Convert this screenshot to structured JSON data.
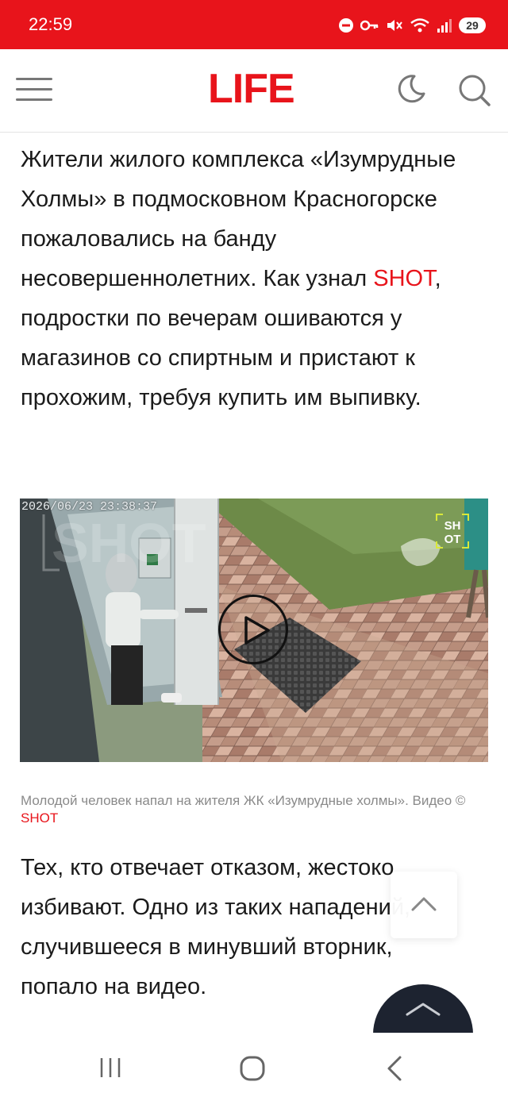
{
  "status_bar": {
    "time": "22:59",
    "icons": [
      "do-not-disturb-icon",
      "key-icon",
      "mute-icon",
      "wifi-icon",
      "signal-icon"
    ],
    "battery": "29"
  },
  "header": {
    "logo": "LIFE",
    "menu_icon": "hamburger-menu-icon",
    "theme_icon": "moon-icon",
    "search_icon": "search-icon"
  },
  "article": {
    "paragraph1_before": "Жители жилого комплекса «Изумрудные Холмы» в подмосковном Красногорске пожаловались на банду несовершеннолетних. Как узнал ",
    "paragraph1_link": "SHOT",
    "paragraph1_after": ", подростки по вечерам ошиваются у магазинов со спиртным и пристают к прохожим, требуя купить им выпивку.",
    "video": {
      "timestamp": "2026/06/23 23:38:37",
      "watermark": "SHOT",
      "play_icon": "play-icon"
    },
    "caption_text": "Молодой человек напал на жителя ЖК «Изумрудные холмы». Видео © ",
    "caption_link": "SHOT",
    "paragraph2": "Тех, кто отвечает отказом, жестоко избивают. Одно из таких нападений, случившееся в минувший вторник, попало на видео."
  },
  "floating": {
    "scroll_up_icon": "chevron-up-icon",
    "bottom_tab_icon": "chevron-up-icon"
  },
  "nav_bar": {
    "recents_icon": "recents-icon",
    "home_icon": "home-icon",
    "back_icon": "back-icon"
  },
  "colors": {
    "accent": "#e8141b",
    "status_bar": "#e8141b",
    "text": "#1b1b1b",
    "caption": "#8a8a8a",
    "dark_tab": "#1d2330"
  }
}
